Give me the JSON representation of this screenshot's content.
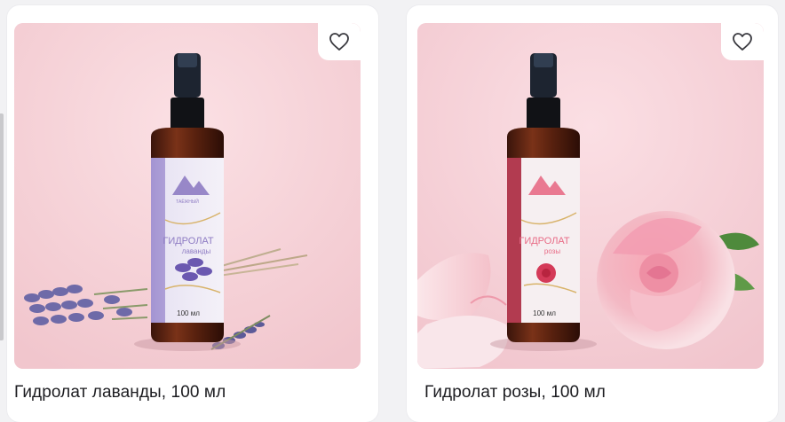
{
  "products": [
    {
      "title": "Гидролат лаванды, 100 мл",
      "label_heading": "ГИДРОЛАТ",
      "label_sub": "лаванды",
      "volume": "100 мл",
      "accent": "#8e7cc3"
    },
    {
      "title": "Гидролат розы, 100 мл",
      "label_heading": "ГИДРОЛАТ",
      "label_sub": "розы",
      "volume": "100 мл",
      "accent": "#e86b86"
    }
  ],
  "icons": {
    "favorite": "heart-outline-icon"
  },
  "colors": {
    "photo_background": "#f6d2d8",
    "card_background": "#ffffff",
    "text": "#1c1c20"
  }
}
